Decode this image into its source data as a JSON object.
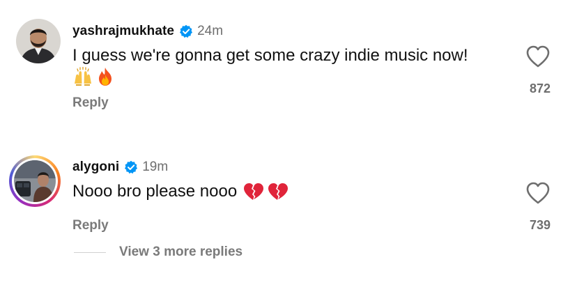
{
  "comments": [
    {
      "username": "yashrajmukhate",
      "verified": true,
      "time": "24m",
      "text": "I guess we're gonna get some crazy indie music now!",
      "emojis": [
        "raising-hands-icon",
        "fire-icon"
      ],
      "reply_label": "Reply",
      "like_count": "872",
      "avatar_story_ring": false
    },
    {
      "username": "alygoni",
      "verified": true,
      "time": "19m",
      "text": "Nooo bro please nooo",
      "emojis": [
        "broken-heart-icon",
        "broken-heart-icon"
      ],
      "reply_label": "Reply",
      "like_count": "739",
      "avatar_story_ring": true
    }
  ],
  "view_replies": {
    "label": "View 3 more replies"
  },
  "colors": {
    "verified_blue": "#0095f6",
    "muted_text": "#7a7a7a",
    "broken_heart_red": "#e0243a"
  }
}
